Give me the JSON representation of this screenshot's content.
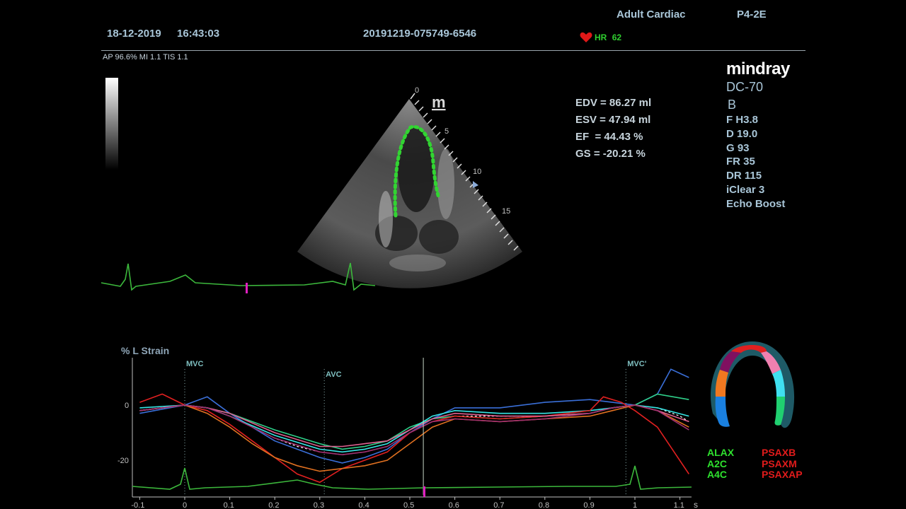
{
  "header": {
    "preset": "Adult Cardiac",
    "probe": "P4-2E",
    "date": "18-12-2019",
    "time": "16:43:03",
    "exam_id": "20191219-075749-6546",
    "hr_label": "HR",
    "hr_value": "62",
    "ap_line": "AP 96.6%  MI 1.1 TIS 1.1"
  },
  "brand": {
    "logo": "mindray",
    "model": "DC-70",
    "mode": "B"
  },
  "params": [
    "F H3.8",
    "D 19.0",
    "G 93",
    "FR 35",
    "DR 115",
    "iClear 3",
    "Echo Boost"
  ],
  "measurements": [
    "EDV = 86.27 ml",
    "ESV = 47.94 ml",
    "EF  = 44.43 %",
    "GS = -20.21 %"
  ],
  "sector": {
    "orientation_marker": "m",
    "depth_labels": [
      "0",
      "5",
      "10",
      "15"
    ]
  },
  "strain_chart": {
    "title": "% L Strain",
    "events": [
      "MVC",
      "AVC",
      "MVC'"
    ],
    "y_ticks": [
      "0",
      "-20"
    ],
    "x_ticks": [
      "-0.1",
      "0",
      "0.1",
      "0.2",
      "0.3",
      "0.4",
      "0.5",
      "0.6",
      "0.7",
      "0.8",
      "0.9",
      "1",
      "1.1"
    ],
    "x_unit": "s"
  },
  "chart_data": {
    "type": "line",
    "title": "% L Strain",
    "xlabel": "s",
    "ylabel": "",
    "xlim": [
      -0.1,
      1.15
    ],
    "ylim": [
      -30,
      15
    ],
    "events": [
      {
        "label": "MVC",
        "x": 0.0
      },
      {
        "label": "AVC",
        "x": 0.31
      },
      {
        "label": "MVC'",
        "x": 0.98
      }
    ],
    "cursor_x": 0.53,
    "series": [
      {
        "color": "#ffffff",
        "x": [
          -0.1,
          0,
          0.05,
          0.1,
          0.15,
          0.2,
          0.25,
          0.3,
          0.35,
          0.4,
          0.45,
          0.5,
          0.55,
          0.6,
          0.7,
          0.8,
          0.9,
          0.95,
          1.0,
          1.05,
          1.1,
          1.12
        ],
        "y": [
          -2,
          0,
          -1,
          -4,
          -8,
          -12,
          -15,
          -17,
          -18,
          -17,
          -15,
          -10,
          -6,
          -4,
          -4,
          -4,
          -3,
          -1,
          0,
          -1,
          -4,
          -6
        ]
      },
      {
        "color": "#3a6fd8",
        "x": [
          -0.1,
          0,
          0.05,
          0.1,
          0.2,
          0.3,
          0.35,
          0.4,
          0.45,
          0.5,
          0.55,
          0.6,
          0.7,
          0.8,
          0.9,
          0.95,
          1.0,
          1.05,
          1.08,
          1.12
        ],
        "y": [
          -3,
          0,
          3,
          -3,
          -13,
          -19,
          -21,
          -19,
          -16,
          -10,
          -5,
          -1,
          -1,
          1,
          2,
          1,
          0,
          4,
          13,
          10
        ]
      },
      {
        "color": "#2fd08a",
        "x": [
          -0.1,
          0,
          0.05,
          0.1,
          0.2,
          0.3,
          0.35,
          0.4,
          0.45,
          0.5,
          0.55,
          0.6,
          0.7,
          0.8,
          0.9,
          0.95,
          1.0,
          1.05,
          1.12
        ],
        "y": [
          -2,
          0,
          -1,
          -3,
          -9,
          -14,
          -16,
          -15,
          -13,
          -8,
          -5,
          -4,
          -5,
          -4,
          -3,
          -1,
          0,
          4,
          2
        ]
      },
      {
        "color": "#36e6e6",
        "x": [
          -0.1,
          0,
          0.05,
          0.1,
          0.2,
          0.3,
          0.35,
          0.4,
          0.45,
          0.5,
          0.55,
          0.6,
          0.7,
          0.8,
          0.9,
          0.95,
          1.0,
          1.05,
          1.12
        ],
        "y": [
          -1,
          0,
          -1,
          -4,
          -11,
          -16,
          -17,
          -16,
          -14,
          -9,
          -4,
          -2,
          -3,
          -3,
          -2,
          -1,
          0,
          -1,
          -4
        ]
      },
      {
        "color": "#e02020",
        "x": [
          -0.1,
          -0.05,
          0,
          0.05,
          0.1,
          0.15,
          0.2,
          0.25,
          0.3,
          0.35,
          0.4,
          0.45,
          0.5,
          0.55,
          0.6,
          0.7,
          0.8,
          0.9,
          0.93,
          0.97,
          1.0,
          1.05,
          1.12
        ],
        "y": [
          1,
          4,
          0,
          -2,
          -7,
          -13,
          -19,
          -25,
          -28,
          -23,
          -20,
          -17,
          -10,
          -6,
          -4,
          -5,
          -4,
          -2,
          3,
          1,
          -2,
          -8,
          -25
        ]
      },
      {
        "color": "#e07020",
        "x": [
          -0.1,
          0,
          0.05,
          0.1,
          0.15,
          0.2,
          0.25,
          0.3,
          0.35,
          0.4,
          0.45,
          0.5,
          0.55,
          0.6,
          0.7,
          0.8,
          0.9,
          0.95,
          1.0,
          1.05,
          1.12
        ],
        "y": [
          -2,
          0,
          -3,
          -8,
          -14,
          -19,
          -22,
          -24,
          -23,
          -22,
          -20,
          -14,
          -8,
          -5,
          -6,
          -5,
          -4,
          -2,
          0,
          -2,
          -8
        ]
      },
      {
        "color": "#e06090",
        "x": [
          -0.1,
          0,
          0.05,
          0.1,
          0.2,
          0.3,
          0.35,
          0.4,
          0.45,
          0.5,
          0.55,
          0.6,
          0.7,
          0.8,
          0.9,
          0.95,
          1.0,
          1.05,
          1.12
        ],
        "y": [
          -2,
          0,
          -1,
          -3,
          -10,
          -15,
          -15,
          -14,
          -13,
          -9,
          -5,
          -3,
          -4,
          -4,
          -3,
          -1,
          0,
          -2,
          -6
        ]
      },
      {
        "color": "#a03070",
        "x": [
          -0.1,
          0,
          0.05,
          0.1,
          0.2,
          0.3,
          0.35,
          0.4,
          0.45,
          0.5,
          0.55,
          0.6,
          0.7,
          0.8,
          0.9,
          0.95,
          1.0,
          1.05,
          1.12
        ],
        "y": [
          -2,
          0,
          -1,
          -4,
          -12,
          -17,
          -18,
          -17,
          -15,
          -10,
          -6,
          -5,
          -6,
          -5,
          -3,
          -1,
          0,
          -2,
          -9
        ]
      }
    ]
  },
  "segment_legend": {
    "left": [
      "ALAX",
      "A2C",
      "A4C"
    ],
    "right": [
      "PSAXB",
      "PSAXM",
      "PSAXAP"
    ]
  },
  "colors": {
    "header_text": "#a9c6d8",
    "ecg": "#3cb83c",
    "marker": "#e020c0",
    "roi": "#32d432",
    "legend_green": "#2ee02e",
    "legend_red": "#e01b1b"
  }
}
